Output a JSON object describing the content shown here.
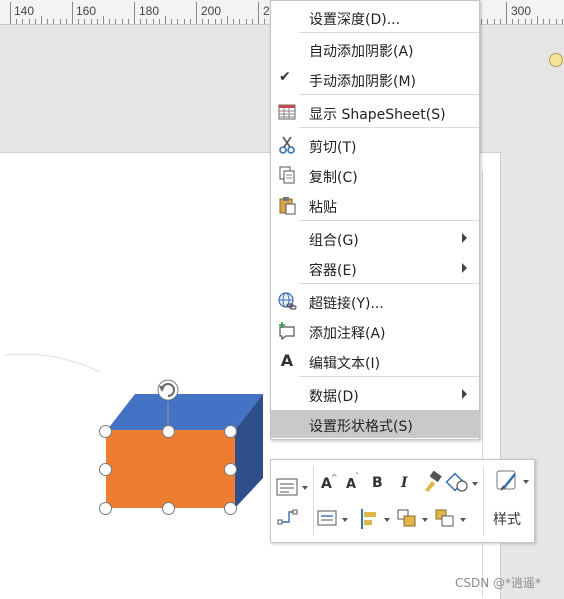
{
  "ruler": {
    "labels": [
      "140",
      "160",
      "180",
      "200",
      "2",
      "300"
    ]
  },
  "context_menu": {
    "items": [
      {
        "label": "设置深度(D)..."
      },
      {
        "label": "自动添加阴影(A)"
      },
      {
        "label": "手动添加阴影(M)",
        "checked": "✔"
      },
      {
        "label": "显示 ShapeSheet(S)",
        "icon": "shapesheet-icon"
      },
      {
        "label": "剪切(T)",
        "icon": "scissors-icon"
      },
      {
        "label": "复制(C)",
        "icon": "copy-icon"
      },
      {
        "label": "粘贴",
        "icon": "paste-icon"
      },
      {
        "label": "组合(G)"
      },
      {
        "label": "容器(E)"
      },
      {
        "label": "超链接(Y)...",
        "icon": "hyperlink-icon"
      },
      {
        "label": "添加注释(A)",
        "icon": "comment-icon"
      },
      {
        "label": "编辑文本(I)",
        "icon": "edit-text-icon",
        "glyph": "A"
      },
      {
        "label": "数据(D)"
      },
      {
        "label": "设置形状格式(S)"
      }
    ]
  },
  "mini_toolbar": {
    "font_grow": "A",
    "font_shrink": "A",
    "bold": "B",
    "italic": "I",
    "style_label": "样式"
  },
  "colors": {
    "box_front": "#ed7d31",
    "box_top": "#4472c4",
    "box_side": "#2f4f8a",
    "menu_highlight": "#c9c9c9"
  },
  "watermark": "CSDN @*逍遥*"
}
